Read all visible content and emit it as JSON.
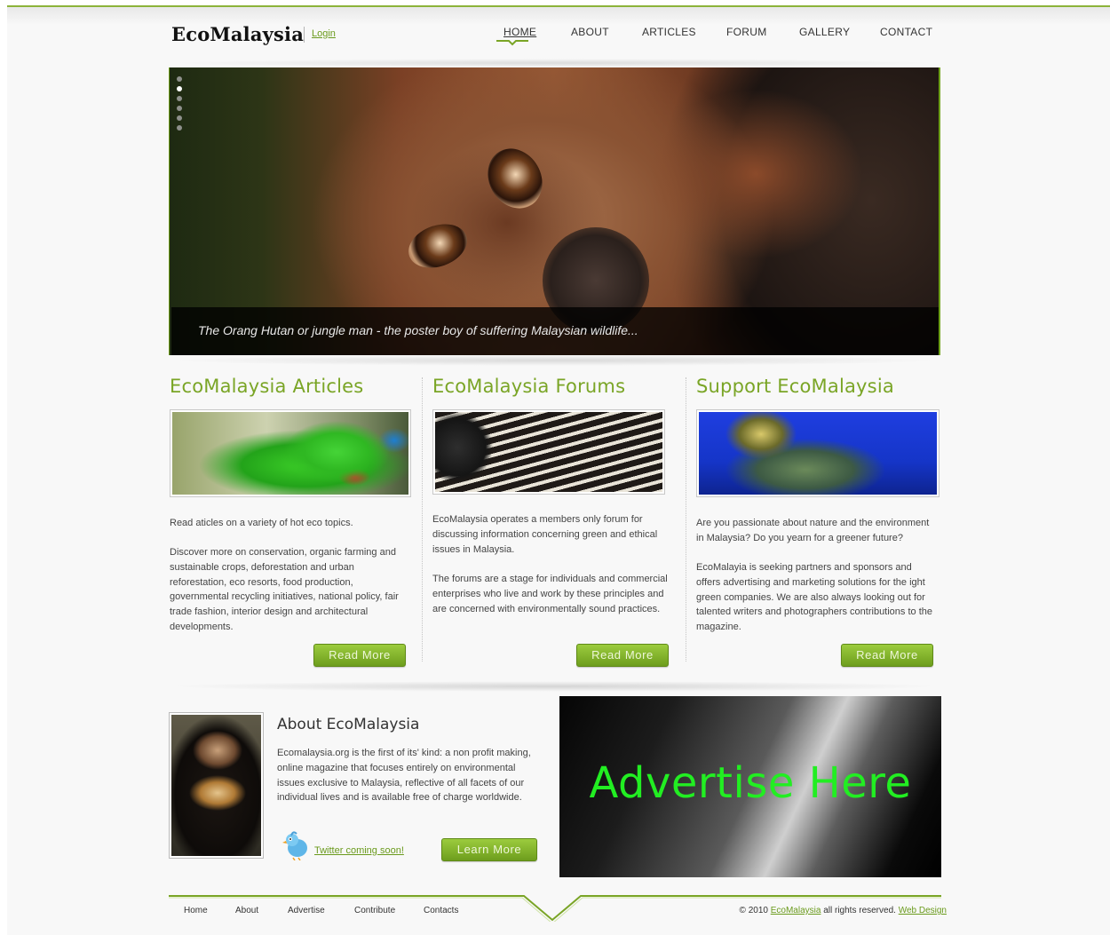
{
  "header": {
    "logo": "EcoMalaysia",
    "login": "Login",
    "nav": [
      {
        "label": "HOME",
        "active": true
      },
      {
        "label": "ABOUT",
        "active": false
      },
      {
        "label": "ARTICLES",
        "active": false
      },
      {
        "label": "FORUM",
        "active": false
      },
      {
        "label": "GALLERY",
        "active": false
      },
      {
        "label": "CONTACT",
        "active": false
      }
    ]
  },
  "hero": {
    "image": "orangutan-photo",
    "caption": "The Orang Hutan or jungle man - the poster boy of suffering Malaysian wildlife...",
    "slide_count": 6,
    "active_slide": 2
  },
  "columns": [
    {
      "title": "EcoMalaysia Articles",
      "image": "green-parrot-photo",
      "paragraphs": [
        "Read aticles on a variety of hot eco topics.",
        "Discover more on conservation, organic farming and sustainable crops, deforestation and urban reforestation, eco resorts, food production, governmental recycling initiatives, national policy, fair trade fashion, interior design and architectural developments."
      ],
      "button": "Read More"
    },
    {
      "title": "EcoMalaysia Forums",
      "image": "baby-tapir-photo",
      "paragraphs": [
        "EcoMalaysia operates a members only forum for discussing information concerning green and ethical issues in Malaysia.",
        "The forums are a stage for individuals and commercial enterprises who live and work by these principles and are concerned with environmentally sound practices."
      ],
      "button": "Read More"
    },
    {
      "title": "Support EcoMalaysia",
      "image": "sea-turtle-photo",
      "paragraphs": [
        "Are you passionate about nature and the environment in Malaysia? Do you yearn for a greener future?",
        "EcoMalayia is seeking partners and sponsors and offers advertising and marketing solutions for the ight green companies. We are also always looking out for talented writers and photographers contributions to the magazine."
      ],
      "button": "Read More"
    }
  ],
  "about": {
    "image": "sun-bear-photo",
    "title": "About EcoMalaysia",
    "text": "Ecomalaysia.org is the first of its' kind: a non profit making, online magazine that focuses entirely on environmental issues exclusive to Malaysia, reflective of all facets of our individual lives and is available free of charge worldwide.",
    "twitter": "Twitter coming soon!",
    "button": "Learn More"
  },
  "advert": {
    "text": "Advertise Here",
    "text_color": "#22ee22"
  },
  "footer": {
    "links": [
      "Home",
      "About",
      "Advertise",
      "Contribute",
      "Contacts"
    ],
    "copyright_prefix": "© 2010",
    "copyright_link": "EcoMalaysia",
    "copyright_middle": "all rights reserved.",
    "design_link": "Web Design"
  },
  "colors": {
    "accent": "#7aa526",
    "button": "#7fb12a",
    "link": "#6a9a1c"
  }
}
